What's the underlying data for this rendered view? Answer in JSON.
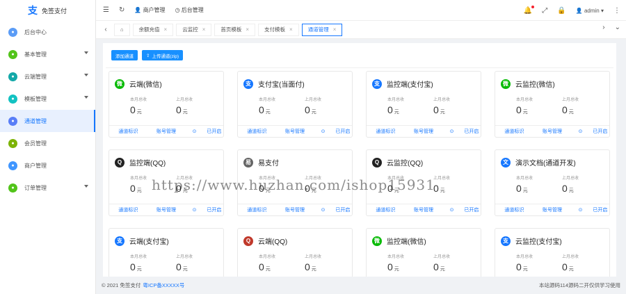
{
  "brand": {
    "name": "免签支付"
  },
  "sidebar": {
    "items": [
      {
        "label": "后台中心",
        "color": "#5b9cf6",
        "arrow": false,
        "active": false
      },
      {
        "label": "基本管理",
        "color": "#52c41a",
        "arrow": true,
        "active": false
      },
      {
        "label": "云端管理",
        "color": "#13a8a8",
        "arrow": true,
        "active": false
      },
      {
        "label": "模板管理",
        "color": "#13c2c2",
        "arrow": true,
        "active": false
      },
      {
        "label": "通道管理",
        "color": "#597ef7",
        "arrow": false,
        "active": true
      },
      {
        "label": "会员管理",
        "color": "#7cb305",
        "arrow": false,
        "active": false
      },
      {
        "label": "商户管理",
        "color": "#4096ff",
        "arrow": false,
        "active": false
      },
      {
        "label": "订单管理",
        "color": "#52c41a",
        "arrow": true,
        "active": false
      }
    ]
  },
  "header": {
    "merchant": "商户管理",
    "backend": "后台管理",
    "user": "admin"
  },
  "tabs": [
    {
      "label": "余额充值",
      "active": false
    },
    {
      "label": "云监控",
      "active": false
    },
    {
      "label": "首页模板",
      "active": false
    },
    {
      "label": "支付模板",
      "active": false
    },
    {
      "label": "通道管理",
      "active": true
    }
  ],
  "toolbar": {
    "add_label": "添加通道",
    "upload_label": "上传通道(zip)"
  },
  "card_labels": {
    "month": "本月总收",
    "last_month": "上月总收",
    "unit": "元",
    "channel_tag": "通道标识",
    "account_mgmt": "账号管理",
    "status": "已开启"
  },
  "cards": [
    {
      "title": "云端(微信)",
      "icon": "wechat-icon",
      "color": "#09bb07",
      "glyph": "微",
      "month": "0",
      "last": "0"
    },
    {
      "title": "支付宝(当面付)",
      "icon": "alipay-icon",
      "color": "#1677ff",
      "glyph": "支",
      "month": "0",
      "last": "0"
    },
    {
      "title": "监控端(支付宝)",
      "icon": "alipay-icon",
      "color": "#1677ff",
      "glyph": "支",
      "month": "0",
      "last": "0"
    },
    {
      "title": "云监控(微信)",
      "icon": "wechat-icon",
      "color": "#09bb07",
      "glyph": "微",
      "month": "0",
      "last": "0"
    },
    {
      "title": "监控端(QQ)",
      "icon": "qq-icon",
      "color": "#222222",
      "glyph": "Q",
      "month": "0",
      "last": "0"
    },
    {
      "title": "易支付",
      "icon": "epay-icon",
      "color": "#666666",
      "glyph": "易",
      "month": "0",
      "last": "0"
    },
    {
      "title": "云监控(QQ)",
      "icon": "qq-icon",
      "color": "#222222",
      "glyph": "Q",
      "month": "0",
      "last": "0"
    },
    {
      "title": "演示文档(通道开发)",
      "icon": "doc-icon",
      "color": "#1677ff",
      "glyph": "文",
      "month": "0",
      "last": "0"
    },
    {
      "title": "云端(支付宝)",
      "icon": "alipay-icon",
      "color": "#1677ff",
      "glyph": "支",
      "month": "0",
      "last": "0"
    },
    {
      "title": "云端(QQ)",
      "icon": "qq-icon",
      "color": "#c0392b",
      "glyph": "Q",
      "month": "0",
      "last": "0"
    },
    {
      "title": "监控端(微信)",
      "icon": "wechat-icon",
      "color": "#09bb07",
      "glyph": "微",
      "month": "0",
      "last": "0"
    },
    {
      "title": "云监控(支付宝)",
      "icon": "alipay-icon",
      "color": "#1677ff",
      "glyph": "支",
      "month": "0",
      "last": "0"
    }
  ],
  "footer": {
    "copyright": "© 2021 免签支付",
    "icp": "粤ICP备XXXXX号",
    "right": "本站源码114源码二开仅供学习使用"
  },
  "watermark": "https://www.huzhan.com/ishop15931"
}
